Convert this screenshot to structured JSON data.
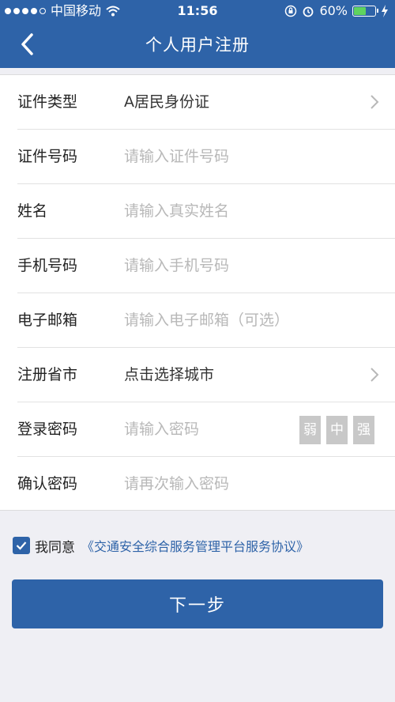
{
  "status_bar": {
    "carrier": "中国移动",
    "time": "11:56",
    "battery": "60%",
    "battery_level": 0.6,
    "wifi_icon": "wifi-icon",
    "lock_icon": "rotation-lock-icon",
    "alarm_icon": "alarm-icon",
    "charge_icon": "charging-bolt-icon",
    "colors": {
      "bar": "#2e63a8",
      "battery_fill": "#5fd35f"
    }
  },
  "nav": {
    "back_icon": "chevron-left-icon",
    "title": "个人用户注册"
  },
  "form": {
    "id_type": {
      "label": "证件类型",
      "value": "A居民身份证"
    },
    "id_number": {
      "label": "证件号码",
      "placeholder": "请输入证件号码"
    },
    "name": {
      "label": "姓名",
      "placeholder": "请输入真实姓名"
    },
    "phone": {
      "label": "手机号码",
      "placeholder": "请输入手机号码"
    },
    "email": {
      "label": "电子邮箱",
      "placeholder": "请输入电子邮箱（可选）"
    },
    "city": {
      "label": "注册省市",
      "value": "点击选择城市"
    },
    "password": {
      "label": "登录密码",
      "placeholder": "请输入密码",
      "strength": [
        "弱",
        "中",
        "强"
      ]
    },
    "confirm": {
      "label": "确认密码",
      "placeholder": "请再次输入密码"
    }
  },
  "agreement": {
    "checked": true,
    "text": "我同意",
    "link": "《交通安全综合服务管理平台服务协议》"
  },
  "next_button": {
    "label": "下一步"
  },
  "colors": {
    "accent": "#2e63a8",
    "background": "#efeff4",
    "placeholder": "#b8b8b8"
  }
}
